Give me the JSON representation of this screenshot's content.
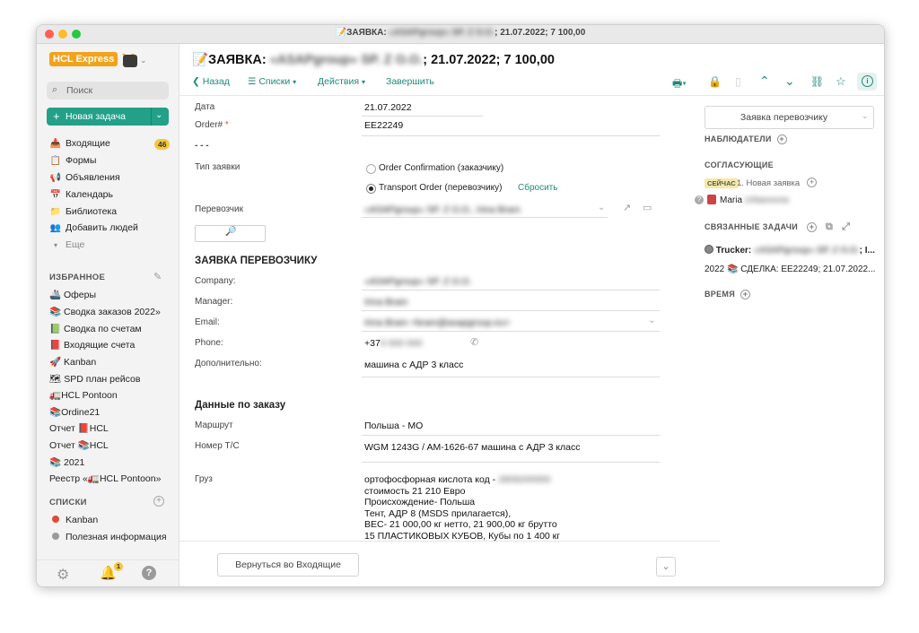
{
  "window": {
    "title_prefix": "📝ЗАЯВКА: ",
    "title_blurred": "«ASAPgroup» SP. Z O.O.",
    "title_suffix": "; 21.07.2022; 7 100,00"
  },
  "sidebar": {
    "logo": "HCL Express",
    "search_placeholder": "Поиск",
    "new_task": "Новая задача",
    "nav": [
      {
        "label": "Входящие",
        "icon": "inbox-icon",
        "badge": "46"
      },
      {
        "label": "Формы",
        "icon": "clipboard-icon"
      },
      {
        "label": "Объявления",
        "icon": "megaphone-icon"
      },
      {
        "label": "Календарь",
        "icon": "calendar-icon"
      },
      {
        "label": "Библиотека",
        "icon": "library-icon"
      },
      {
        "label": "Добавить людей",
        "icon": "add-people-icon"
      },
      {
        "label": "Еще",
        "icon": "chevron-down-icon"
      }
    ],
    "favorites_header": "ИЗБРАННОЕ",
    "favorites": [
      "🚢 Оферы",
      "📚 Сводка заказов 2022»",
      "📗 Сводка по счетам",
      "📕 Входящие счета",
      "🚀 Kanban",
      "🗺 SPD план рейсов",
      "🚛HCL Pontoon",
      "📚Ordine21",
      "Отчет 📕HCL",
      "Отчет 📚HCL",
      "📚 2021",
      "Реестр «🚛HCL Pontoon»"
    ],
    "lists_header": "СПИСКИ",
    "lists": [
      {
        "label": "Kanban",
        "color": "#e04a3a"
      },
      {
        "label": "Полезная информация",
        "color": "#9a9a9a"
      }
    ],
    "bell_badge": "1"
  },
  "header": {
    "title_prefix": "📝ЗАЯВКА: ",
    "title_blurred": "«ASAPgroup» SP. Z O.O.",
    "title_suffix": "; 21.07.2022; 7 100,00",
    "toolbar": {
      "back": "Назад",
      "lists": "Списки",
      "actions": "Действия",
      "finish": "Завершить"
    }
  },
  "form": {
    "date_label": "Дата",
    "date_value": "21.07.2022",
    "order_label": "Order#",
    "order_required": "*",
    "order_value": "EE22249",
    "dashes": "- - -",
    "type_label": "Тип заявки",
    "option1": "Order Confirmation (заказчику)",
    "option2": "Transport Order (перевозчику)",
    "reset": "Сбросить",
    "carrier_label": "Перевозчик",
    "carrier_value": "«ASAPgroup» SP. Z O.O., Irina Bram",
    "section1": "ЗАЯВКА ПЕРЕВОЗЧИКУ",
    "company_label": "Company:",
    "company_value": "«ASAPgroup» SP. Z O.O.",
    "manager_label": "Manager:",
    "manager_value": "Irina Bram",
    "email_label": "Email:",
    "email_value": "Irina Bram <bram@asapgroup.eu>",
    "phone_label": "Phone:",
    "phone_prefix": "+37",
    "phone_blurred": "0 000 000",
    "extra_label": "Дополнительно:",
    "extra_value": "машина с АДР 3 класс",
    "section2": "Данные по заказу",
    "route_label": "Маршрут",
    "route_value": "Польша - МО",
    "vehicle_label": "Номер Т/С",
    "vehicle_value": "WGM 1243G / AM-1626-67 машина с АДР 3 класс",
    "cargo_label": "Груз",
    "cargo_line1": "ортофосфорная кислота код -",
    "cargo_line1_blurred": "2809200000",
    "cargo_lines": [
      "стоимость 21 210 Евро",
      "Происхождение- Польша",
      "Тент, АДР 8 (MSDS прилагается),",
      "ВЕС- 21 000,00 кг нетто, 21 900,00 кг брутто",
      "15 ПЛАСТИКОВЫХ КУБОВ, Кубы по 1 400 кг"
    ],
    "return_button": "Вернуться во Входящие"
  },
  "right_panel": {
    "status_button": "Заявка перевозчику",
    "observers": "НАБЛЮДАТЕЛИ",
    "approvers": "СОГЛАСУЮЩИЕ",
    "now_badge": "СЕЙЧАС",
    "approval_step": "1. Новая заявка",
    "approver_name": "Maria",
    "approver_blurred": "Urbanovna",
    "related": "СВЯЗАННЫЕ ЗАДАЧИ",
    "task1_prefix": "Trucker: ",
    "task1_blurred": "«ASAPgroup» SP. Z O.O.",
    "task1_suffix": "; I...",
    "task2": "2022 📚 СДЕЛКА: EE22249; 21.07.2022...",
    "time": "ВРЕМЯ"
  }
}
